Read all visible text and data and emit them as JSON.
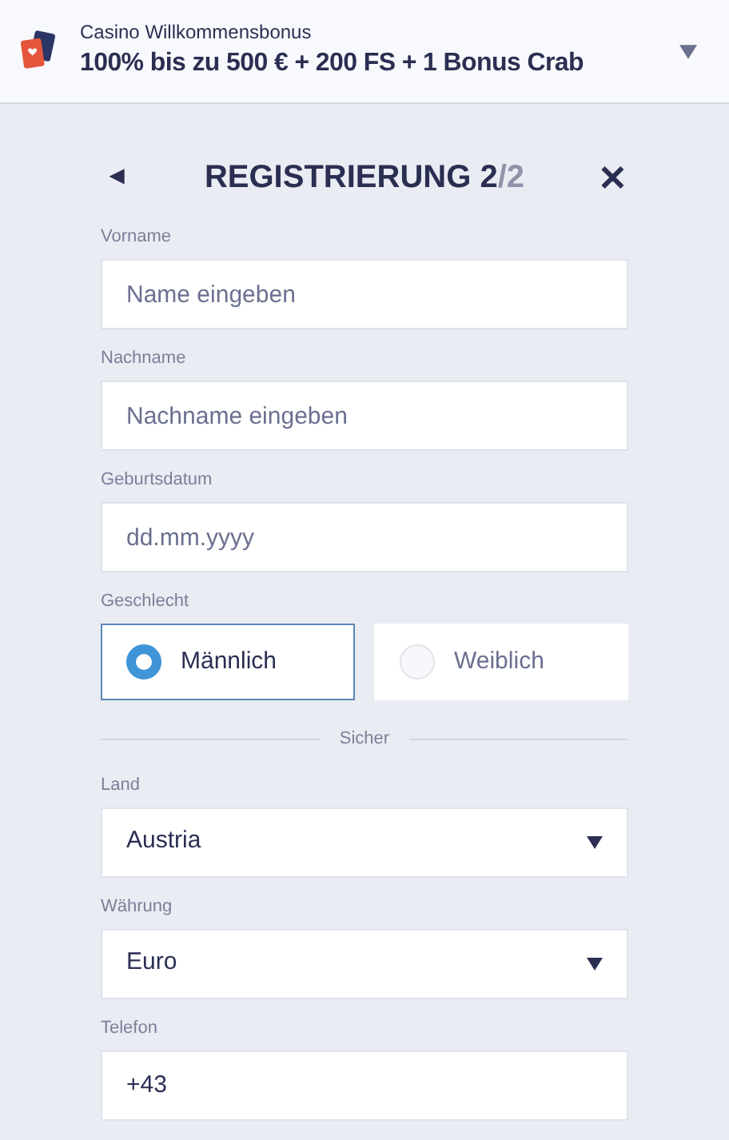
{
  "bonus": {
    "caption": "Casino Willkommensbonus",
    "offer": "100% bis zu 500 € + 200 FS + 1 Bonus Crab"
  },
  "header": {
    "back": "◄",
    "title": "REGISTRIERUNG 2",
    "step_total": "/2",
    "close": "✕"
  },
  "form": [
    {
      "kind": "text",
      "label": "Vorname",
      "placeholder": "Name eingeben"
    },
    {
      "kind": "text",
      "label": "Nachname",
      "placeholder": "Nachname eingeben"
    },
    {
      "kind": "text",
      "label": "Geburtsdatum",
      "placeholder": "dd.mm.yyyy"
    },
    {
      "kind": "radio",
      "label": "Geschlecht",
      "options": [
        {
          "label": "Männlich",
          "selected": true
        },
        {
          "label": "Weiblich",
          "selected": false
        }
      ]
    },
    {
      "kind": "divider",
      "label": "Sicher"
    },
    {
      "kind": "select",
      "label": "Land",
      "value": "Austria"
    },
    {
      "kind": "select",
      "label": "Währung",
      "value": "Euro"
    },
    {
      "kind": "text",
      "label": "Telefon",
      "value": "+43"
    }
  ]
}
